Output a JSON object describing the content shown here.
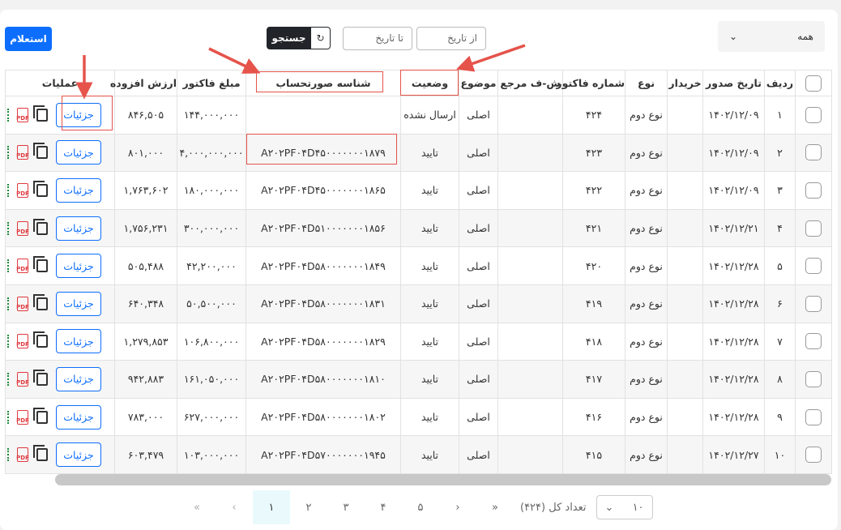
{
  "toolbar": {
    "inquiry_label": "استعلام",
    "search_label": "جستجو",
    "refresh_icon": "refresh-icon",
    "to_date_placeholder": "تا تاریخ",
    "from_date_placeholder": "از تاریخ",
    "filter_value": "همه"
  },
  "table": {
    "headers": [
      "ردیف",
      "تاریخ صدور",
      "خریدار",
      "نوع",
      "شماره فاکتور",
      "ش-ف مرجع",
      "موضوع",
      "وضعیت",
      "شناسه صورتحساب",
      "مبلغ فاکتور",
      "ارزش افزوده",
      "عملیات"
    ],
    "details_label": "جزئیات",
    "pdf_label": "PDF",
    "rows": [
      {
        "n": "۱",
        "date": "۱۴۰۲/۱۲/۰۹",
        "buyer": "",
        "type": "نوع دوم",
        "inv": "۴۲۴",
        "ref": "",
        "subject": "اصلی",
        "status": "ارسال نشده",
        "id": "",
        "amount": "۱۴۴,۰۰۰,۰۰۰",
        "vat": "۸۴۶,۵۰۵"
      },
      {
        "n": "۲",
        "date": "۱۴۰۲/۱۲/۰۹",
        "buyer": "",
        "type": "نوع دوم",
        "inv": "۴۲۳",
        "ref": "",
        "subject": "اصلی",
        "status": "تایید",
        "id": "A۲۰۲PF۰۴D۴۵۰۰۰۰۰۰۰۱۸۷۹",
        "amount": "۴,۰۰۰,۰۰۰,۰۰۰",
        "vat": "۸۰۱,۰۰۰"
      },
      {
        "n": "۳",
        "date": "۱۴۰۲/۱۲/۰۹",
        "buyer": "",
        "type": "نوع دوم",
        "inv": "۴۲۲",
        "ref": "",
        "subject": "اصلی",
        "status": "تایید",
        "id": "A۲۰۲PF۰۴D۴۵۰۰۰۰۰۰۰۱۸۶۵",
        "amount": "۱۸۰,۰۰۰,۰۰۰",
        "vat": "۱,۷۶۳,۶۰۲"
      },
      {
        "n": "۴",
        "date": "۱۴۰۲/۱۲/۲۱",
        "buyer": "",
        "type": "نوع دوم",
        "inv": "۴۲۱",
        "ref": "",
        "subject": "اصلی",
        "status": "تایید",
        "id": "A۲۰۲PF۰۴D۵۱۰۰۰۰۰۰۰۱۸۵۶",
        "amount": "۳۰۰,۰۰۰,۰۰۰",
        "vat": "۱,۷۵۶,۲۳۱"
      },
      {
        "n": "۵",
        "date": "۱۴۰۲/۱۲/۲۸",
        "buyer": "",
        "type": "نوع دوم",
        "inv": "۴۲۰",
        "ref": "",
        "subject": "اصلی",
        "status": "تایید",
        "id": "A۲۰۲PF۰۴D۵۸۰۰۰۰۰۰۰۱۸۴۹",
        "amount": "۴۲,۲۰۰,۰۰۰",
        "vat": "۵۰۵,۴۸۸"
      },
      {
        "n": "۶",
        "date": "۱۴۰۲/۱۲/۲۸",
        "buyer": "",
        "type": "نوع دوم",
        "inv": "۴۱۹",
        "ref": "",
        "subject": "اصلی",
        "status": "تایید",
        "id": "A۲۰۲PF۰۴D۵۸۰۰۰۰۰۰۰۱۸۳۱",
        "amount": "۵۰,۵۰۰,۰۰۰",
        "vat": "۶۴۰,۳۴۸"
      },
      {
        "n": "۷",
        "date": "۱۴۰۲/۱۲/۲۸",
        "buyer": "",
        "type": "نوع دوم",
        "inv": "۴۱۸",
        "ref": "",
        "subject": "اصلی",
        "status": "تایید",
        "id": "A۲۰۲PF۰۴D۵۸۰۰۰۰۰۰۰۱۸۲۹",
        "amount": "۱۰۶,۸۰۰,۰۰۰",
        "vat": "۱,۲۷۹,۸۵۳"
      },
      {
        "n": "۸",
        "date": "۱۴۰۲/۱۲/۲۸",
        "buyer": "",
        "type": "نوع دوم",
        "inv": "۴۱۷",
        "ref": "",
        "subject": "اصلی",
        "status": "تایید",
        "id": "A۲۰۲PF۰۴D۵۸۰۰۰۰۰۰۰۱۸۱۰",
        "amount": "۱۶۱,۰۵۰,۰۰۰",
        "vat": "۹۴۲,۸۸۳"
      },
      {
        "n": "۹",
        "date": "۱۴۰۲/۱۲/۲۸",
        "buyer": "",
        "type": "نوع دوم",
        "inv": "۴۱۶",
        "ref": "",
        "subject": "اصلی",
        "status": "تایید",
        "id": "A۲۰۲PF۰۴D۵۸۰۰۰۰۰۰۰۱۸۰۲",
        "amount": "۶۲۷,۰۰۰,۰۰۰",
        "vat": "۷۸۳,۰۰۰"
      },
      {
        "n": "۱۰",
        "date": "۱۴۰۲/۱۲/۲۷",
        "buyer": "",
        "type": "نوع دوم",
        "inv": "۴۱۵",
        "ref": "",
        "subject": "اصلی",
        "status": "تایید",
        "id": "A۲۰۲PF۰۴D۵۷۰۰۰۰۰۰۰۱۹۴۵",
        "amount": "۱۰۳,۰۰۰,۰۰۰",
        "vat": "۶۰۳,۴۷۹"
      }
    ]
  },
  "pagination": {
    "first": "«",
    "prev": "‹",
    "pages": [
      "۱",
      "۲",
      "۳",
      "۴",
      "۵"
    ],
    "active_page": "۱",
    "next": "›",
    "last": "»",
    "total_label": "تعداد کل (۴۲۴)",
    "page_size": "۱۰"
  },
  "colors": {
    "primary": "#0d6efd",
    "annotation": "#e5534b",
    "dark": "#212529"
  }
}
